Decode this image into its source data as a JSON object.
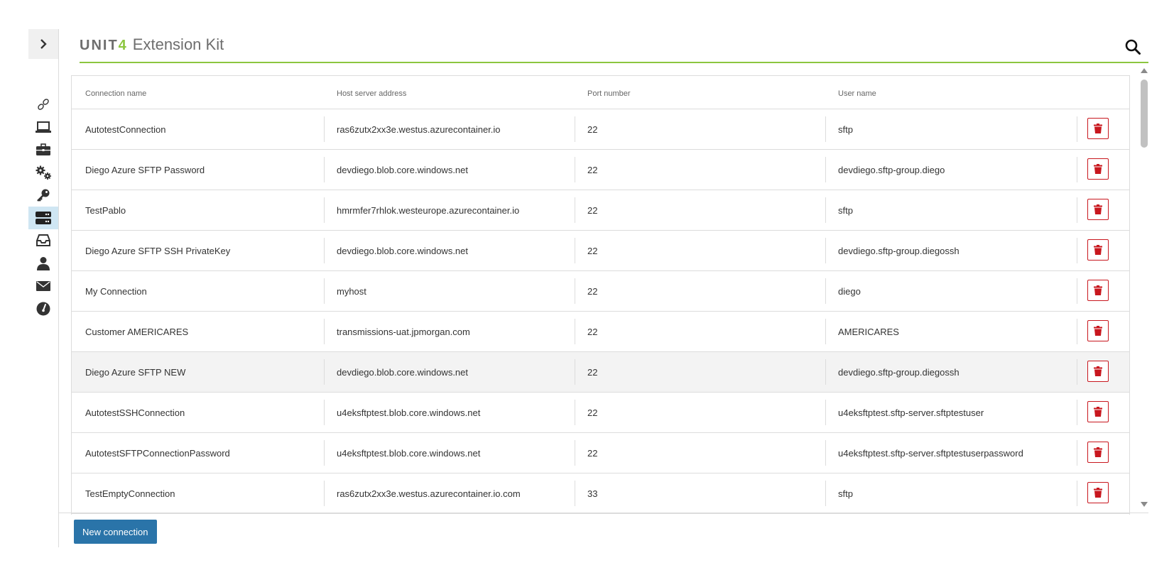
{
  "header": {
    "brand_unit": "UNIT",
    "brand_four": "4",
    "app_title": "Extension Kit",
    "search_icon": "search-icon",
    "accent_color": "#8cc63f"
  },
  "sidebar": {
    "toggle_icon": "chevron-right-icon",
    "items": [
      {
        "icon": "link-icon",
        "active": false
      },
      {
        "icon": "laptop-icon",
        "active": false
      },
      {
        "icon": "briefcase-icon",
        "active": false
      },
      {
        "icon": "gears-icon",
        "active": false
      },
      {
        "icon": "key-icon",
        "active": false
      },
      {
        "icon": "server-icon",
        "active": true
      },
      {
        "icon": "inbox-icon",
        "active": false
      },
      {
        "icon": "user-icon",
        "active": false
      },
      {
        "icon": "envelope-icon",
        "active": false
      },
      {
        "icon": "gauge-icon",
        "active": false
      }
    ],
    "active_color": "#cfe6f3"
  },
  "table": {
    "columns": [
      "Connection name",
      "Host server address",
      "Port number",
      "User name"
    ],
    "rows": [
      {
        "name": "AutotestConnection",
        "host": "ras6zutx2xx3e.westus.azurecontainer.io",
        "port": "22",
        "user": "sftp"
      },
      {
        "name": "Diego Azure SFTP Password",
        "host": "devdiego.blob.core.windows.net",
        "port": "22",
        "user": "devdiego.sftp-group.diego"
      },
      {
        "name": "TestPablo",
        "host": "hmrmfer7rhlok.westeurope.azurecontainer.io",
        "port": "22",
        "user": "sftp"
      },
      {
        "name": "Diego Azure SFTP SSH PrivateKey",
        "host": "devdiego.blob.core.windows.net",
        "port": "22",
        "user": "devdiego.sftp-group.diegossh"
      },
      {
        "name": "My Connection",
        "host": "myhost",
        "port": "22",
        "user": "diego"
      },
      {
        "name": "Customer AMERICARES",
        "host": "transmissions-uat.jpmorgan.com",
        "port": "22",
        "user": "AMERICARES"
      },
      {
        "name": "Diego Azure SFTP NEW",
        "host": "devdiego.blob.core.windows.net",
        "port": "22",
        "user": "devdiego.sftp-group.diegossh",
        "highlighted": true
      },
      {
        "name": "AutotestSSHConnection",
        "host": "u4eksftptest.blob.core.windows.net",
        "port": "22",
        "user": "u4eksftptest.sftp-server.sftptestuser"
      },
      {
        "name": "AutotestSFTPConnectionPassword",
        "host": "u4eksftptest.blob.core.windows.net",
        "port": "22",
        "user": "u4eksftptest.sftp-server.sftptestuserpassword"
      },
      {
        "name": "TestEmptyConnection",
        "host": "ras6zutx2xx3e.westus.azurecontainer.io.com",
        "port": "33",
        "user": "sftp"
      }
    ],
    "delete_icon": "trash-icon",
    "delete_color": "#c8171e"
  },
  "footer": {
    "new_connection_label": "New connection",
    "button_color": "#2a74a9"
  }
}
